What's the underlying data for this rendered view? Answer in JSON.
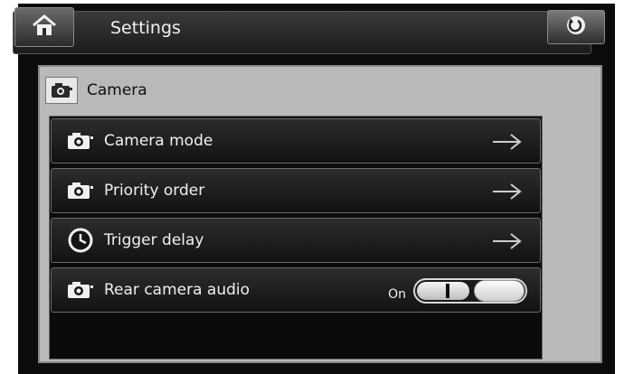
{
  "header": {
    "title": "Settings",
    "home_icon": "home-icon",
    "back_icon": "back-icon"
  },
  "section": {
    "title": "Camera",
    "icon": "camera-icon"
  },
  "items": [
    {
      "label": "Camera mode",
      "icon": "camera-icon",
      "control": "arrow-icon"
    },
    {
      "label": "Priority order",
      "icon": "camera-icon",
      "control": "arrow-icon"
    },
    {
      "label": "Trigger delay",
      "icon": "clock-icon",
      "control": "arrow-icon"
    },
    {
      "label": "Rear camera audio",
      "icon": "camera-icon",
      "control": "toggle",
      "toggle_state": "On"
    }
  ]
}
